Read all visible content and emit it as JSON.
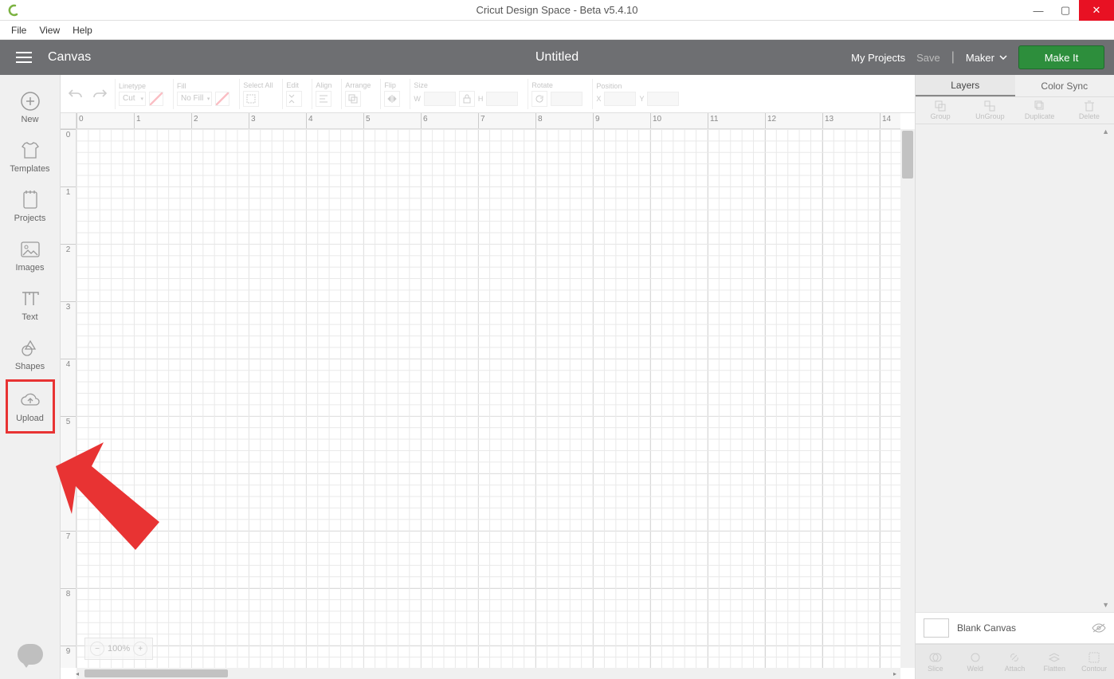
{
  "window": {
    "title": "Cricut Design Space - Beta v5.4.10"
  },
  "menu": {
    "file": "File",
    "view": "View",
    "help": "Help"
  },
  "header": {
    "canvas": "Canvas",
    "docTitle": "Untitled",
    "myProjects": "My Projects",
    "save": "Save",
    "divider": "|",
    "machine": "Maker",
    "makeIt": "Make It"
  },
  "sidebar": {
    "new": "New",
    "templates": "Templates",
    "projects": "Projects",
    "images": "Images",
    "text": "Text",
    "shapes": "Shapes",
    "upload": "Upload"
  },
  "propbar": {
    "linetypeLabel": "Linetype",
    "linetypeValue": "Cut",
    "fillLabel": "Fill",
    "fillValue": "No Fill",
    "selectAll": "Select All",
    "edit": "Edit",
    "align": "Align",
    "arrange": "Arrange",
    "flip": "Flip",
    "size": "Size",
    "wLabel": "W",
    "hLabel": "H",
    "rotate": "Rotate",
    "position": "Position",
    "xLabel": "X",
    "yLabel": "Y"
  },
  "rulerH": [
    "0",
    "1",
    "2",
    "3",
    "4",
    "5",
    "6",
    "7",
    "8",
    "9",
    "10",
    "11",
    "12",
    "13",
    "14"
  ],
  "rulerV": [
    "0",
    "1",
    "2",
    "3",
    "4",
    "5",
    "6",
    "7",
    "8",
    "9"
  ],
  "zoom": {
    "level": "100%"
  },
  "rightPanel": {
    "tabLayers": "Layers",
    "tabColorSync": "Color Sync",
    "opGroup": "Group",
    "opUngroup": "UnGroup",
    "opDuplicate": "Duplicate",
    "opDelete": "Delete",
    "blankCanvas": "Blank Canvas",
    "bSlice": "Slice",
    "bWeld": "Weld",
    "bAttach": "Attach",
    "bFlatten": "Flatten",
    "bContour": "Contour"
  }
}
